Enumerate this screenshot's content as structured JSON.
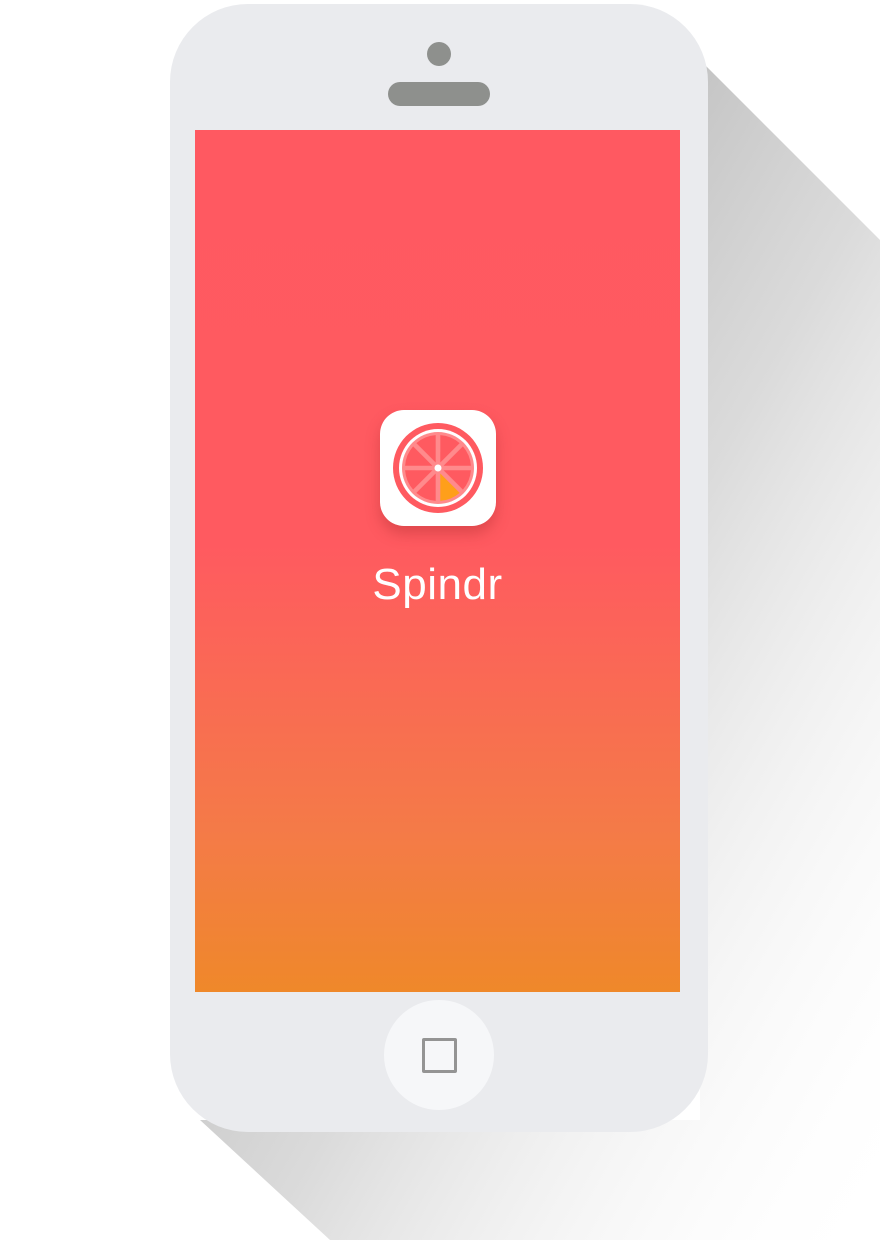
{
  "app": {
    "name": "Spindr",
    "icon_name": "grapefruit-slice-icon"
  },
  "device": {
    "type": "phone mockup",
    "home_icon_name": "square-home-icon"
  },
  "colors": {
    "screen_gradient_top": "#ff5961",
    "screen_gradient_bottom": "#ef882a",
    "phone_body": "#eaebee",
    "icon_accent": "#ff9f1a"
  }
}
